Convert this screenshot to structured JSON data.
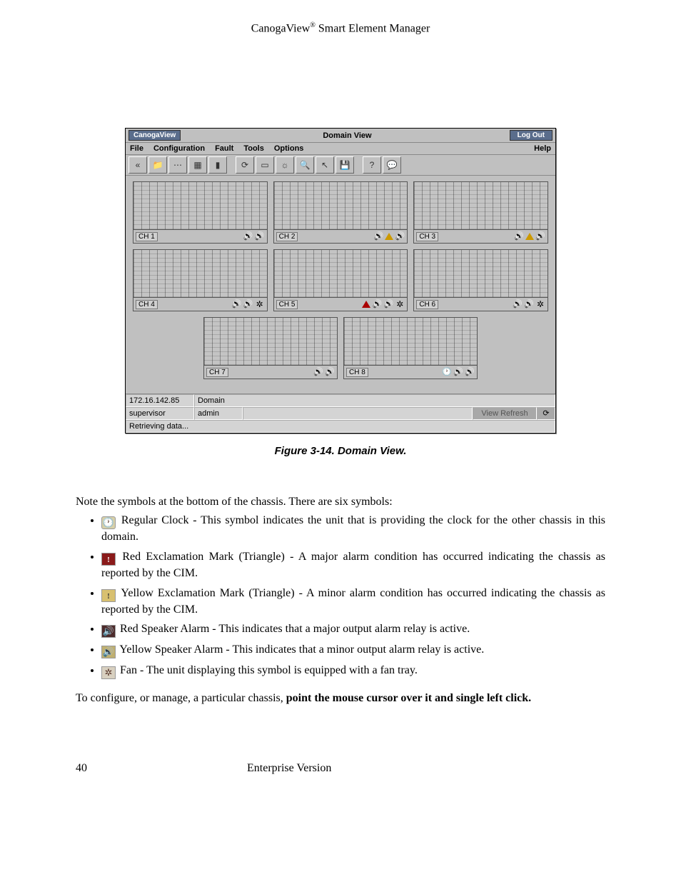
{
  "header": {
    "product": "CanogaView",
    "reg": "®",
    "suffix": " Smart Element Manager"
  },
  "app": {
    "titlebar": {
      "brand": "CanogaView",
      "title": "Domain View",
      "logout": "Log Out"
    },
    "menubar": {
      "file": "File",
      "configuration": "Configuration",
      "fault": "Fault",
      "tools": "Tools",
      "options": "Options",
      "help": "Help"
    },
    "chassis": [
      {
        "label": "CH 1",
        "symbols": [
          "spk",
          "spk"
        ]
      },
      {
        "label": "CH 2",
        "symbols": [
          "spk",
          "warn-y",
          "spk"
        ]
      },
      {
        "label": "CH 3",
        "symbols": [
          "spk",
          "warn-y",
          "spk"
        ]
      },
      {
        "label": "CH 4",
        "symbols": [
          "spk",
          "spk",
          "fan"
        ]
      },
      {
        "label": "CH 5",
        "symbols": [
          "warn-r",
          "spk",
          "spk",
          "fan"
        ]
      },
      {
        "label": "CH 6",
        "symbols": [
          "spk",
          "spk",
          "fan"
        ]
      },
      {
        "label": "CH 7",
        "symbols": [
          "spk",
          "spk"
        ]
      },
      {
        "label": "CH 8",
        "symbols": [
          "clock",
          "spk",
          "spk"
        ]
      }
    ],
    "status": {
      "ip": "172.16.142.85",
      "domain": "Domain",
      "user": "supervisor",
      "role": "admin",
      "refresh": "View Refresh",
      "message": "Retrieving data..."
    }
  },
  "figure_caption": "Figure 3-14. Domain View.",
  "intro": "Note the symbols at the bottom of the chassis. There are six symbols:",
  "bullets": {
    "b1": "Regular Clock - This symbol indicates the unit that is providing the clock for the other chassis in this domain.",
    "b2": "Red Exclamation Mark (Triangle) - A major alarm condition has occurred indicating the chassis as reported by the CIM.",
    "b3": "Yellow Exclamation Mark (Triangle) - A minor alarm condition has occurred indicating the chassis as reported by the CIM.",
    "b4": "Red Speaker Alarm - This indicates that a major output alarm relay is active.",
    "b5": "Yellow Speaker Alarm - This indicates that a minor output alarm relay is active.",
    "b6": "Fan - The unit displaying this symbol is equipped with a fan tray."
  },
  "final": {
    "pre": "To configure, or manage, a particular chassis, ",
    "bold": "point the mouse cursor over it and single left click."
  },
  "footer": {
    "page": "40",
    "version": "Enterprise Version"
  }
}
